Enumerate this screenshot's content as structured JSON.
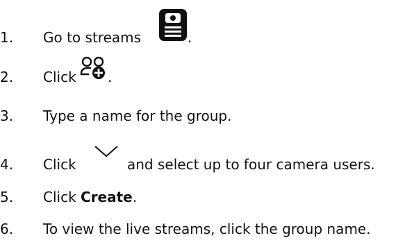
{
  "steps": [
    {
      "number": "1.",
      "text_before": "Go to streams",
      "icon": "streams-icon",
      "text_after": "."
    },
    {
      "number": "2.",
      "text_before": "Click",
      "icon": "add-group-icon",
      "text_after": "."
    },
    {
      "number": "3.",
      "text": "Type a name for the group."
    },
    {
      "number": "4.",
      "text_before": "Click",
      "icon": "chevron-down-icon",
      "text_after": "and select up to four camera users."
    },
    {
      "number": "5.",
      "text_before": "Click",
      "bold": "Create",
      "text_after": "."
    },
    {
      "number": "6.",
      "text": "To view the live streams, click the group name."
    }
  ]
}
